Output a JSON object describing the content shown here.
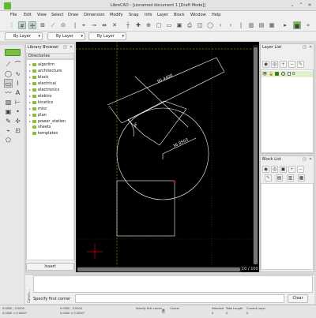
{
  "window": {
    "title": "LibreCAD - [unnamed document 1 [Draft Mode]]"
  },
  "menu": [
    "File",
    "Edit",
    "View",
    "Select",
    "Draw",
    "Dimension",
    "Modify",
    "Snap",
    "Info",
    "Layer",
    "Block",
    "Window",
    "Help"
  ],
  "pen": {
    "color": "By Layer",
    "width": "By Layer",
    "type": "By Layer"
  },
  "library": {
    "title": "Library Browser",
    "header": "Directories",
    "dirs": [
      "algoritm",
      "architecture",
      "block",
      "electrical",
      "electronics",
      "elektro",
      "kinetics",
      "misc",
      "plan",
      "power_station",
      "sheets",
      "templates"
    ],
    "insert": "Insert"
  },
  "canvas": {
    "dim1": "95.4400",
    "dim2": "36.8503",
    "dim3": "38°",
    "grid": "10 / 100",
    "colors": {
      "bg": "#000000",
      "entity": "#ffffff",
      "grid": "#c8a000",
      "crosshair": "#e00000"
    }
  },
  "layers": {
    "title": "Layer List",
    "items": [
      {
        "name": "0"
      }
    ]
  },
  "blocks": {
    "title": "Block List"
  },
  "command": {
    "label": "Comm...",
    "prompt": "Specify first corner",
    "clear": "Clear"
  },
  "status": {
    "coord_abs1": "0.0000 , 0.0000",
    "coord_abs2": "0.0000 < 0.0000°",
    "coord_rel1": "0.0000 , 0.0000",
    "coord_rel2": "0.0000 < 0.0000°",
    "snap_label": "Specify first corner",
    "cancel_label": "Cancel",
    "selected_label": "Selected",
    "selected_value": "0",
    "length_label": "Total Length",
    "length_value": "0",
    "layer_label": "Current Layer",
    "layer_value": "0"
  }
}
